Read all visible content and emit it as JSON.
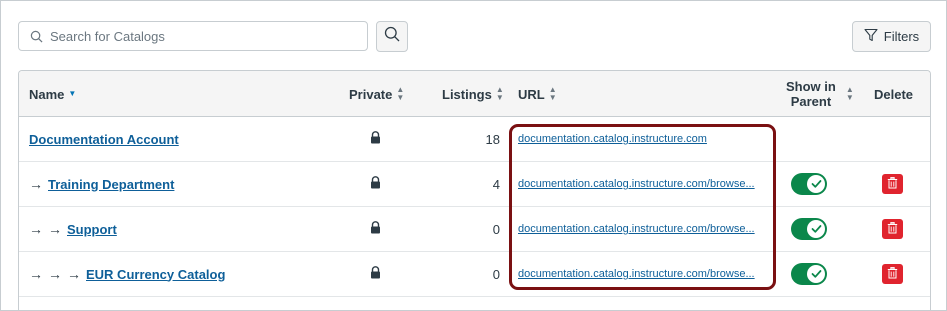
{
  "search": {
    "placeholder": "Search for Catalogs",
    "value": ""
  },
  "toolbar": {
    "filters_label": "Filters"
  },
  "table": {
    "headers": {
      "name": "Name",
      "private": "Private",
      "listings": "Listings",
      "url": "URL",
      "show_in_parent_line1": "Show in",
      "show_in_parent_line2": "Parent",
      "delete": "Delete"
    },
    "rows": [
      {
        "name": "Documentation Account",
        "listings": "18",
        "url": "documentation.catalog.instructure.com"
      },
      {
        "name": "Training Department",
        "listings": "4",
        "url": "documentation.catalog.instructure.com/browse..."
      },
      {
        "name": "Support",
        "listings": "0",
        "url": "documentation.catalog.instructure.com/browse..."
      },
      {
        "name": "EUR Currency Catalog",
        "listings": "0",
        "url": "documentation.catalog.instructure.com/browse..."
      }
    ]
  },
  "colors": {
    "link": "#0e5f99",
    "toggle_on": "#0b874b",
    "delete": "#e0242e",
    "highlight": "#7a1012"
  },
  "icons": {
    "search": "search-icon",
    "filter": "filter-icon",
    "lock": "lock-icon",
    "check": "check-icon",
    "trash": "trash-icon",
    "arrow": "arrow-right-icon"
  }
}
